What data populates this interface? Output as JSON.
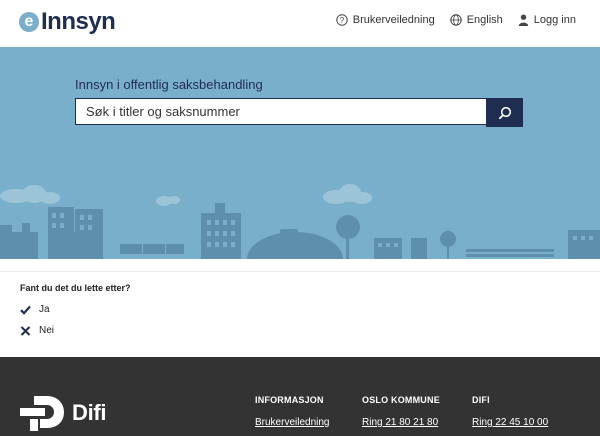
{
  "header": {
    "logo_letter": "e",
    "logo_text": "Innsyn",
    "nav": {
      "guide_label": "Brukerveiledning",
      "language_label": "English",
      "login_label": "Logg inn"
    }
  },
  "hero": {
    "label": "Innsyn i offentlig saksbehandling",
    "search_placeholder": "Søk i titler og saksnummer"
  },
  "feedback": {
    "question": "Fant du det du lette etter?",
    "yes_label": "Ja",
    "no_label": "Nei"
  },
  "footer": {
    "logo_text": "Difi",
    "columns": [
      {
        "heading": "INFORMASJON",
        "link": "Brukerveiledning"
      },
      {
        "heading": "OSLO KOMMUNE",
        "link": "Ring 21 80 21 80"
      },
      {
        "heading": "DIFI",
        "link": "Ring 22 45 10 00"
      }
    ]
  },
  "colors": {
    "navy": "#1e2d50",
    "hero_blue": "#7aafcb",
    "skyline": "#5f8faf",
    "footer_bg": "#333333"
  },
  "icons": [
    "question-circle-icon",
    "globe-icon",
    "user-icon",
    "search-icon",
    "checkmark-icon",
    "close-icon",
    "difi-logo-icon"
  ]
}
